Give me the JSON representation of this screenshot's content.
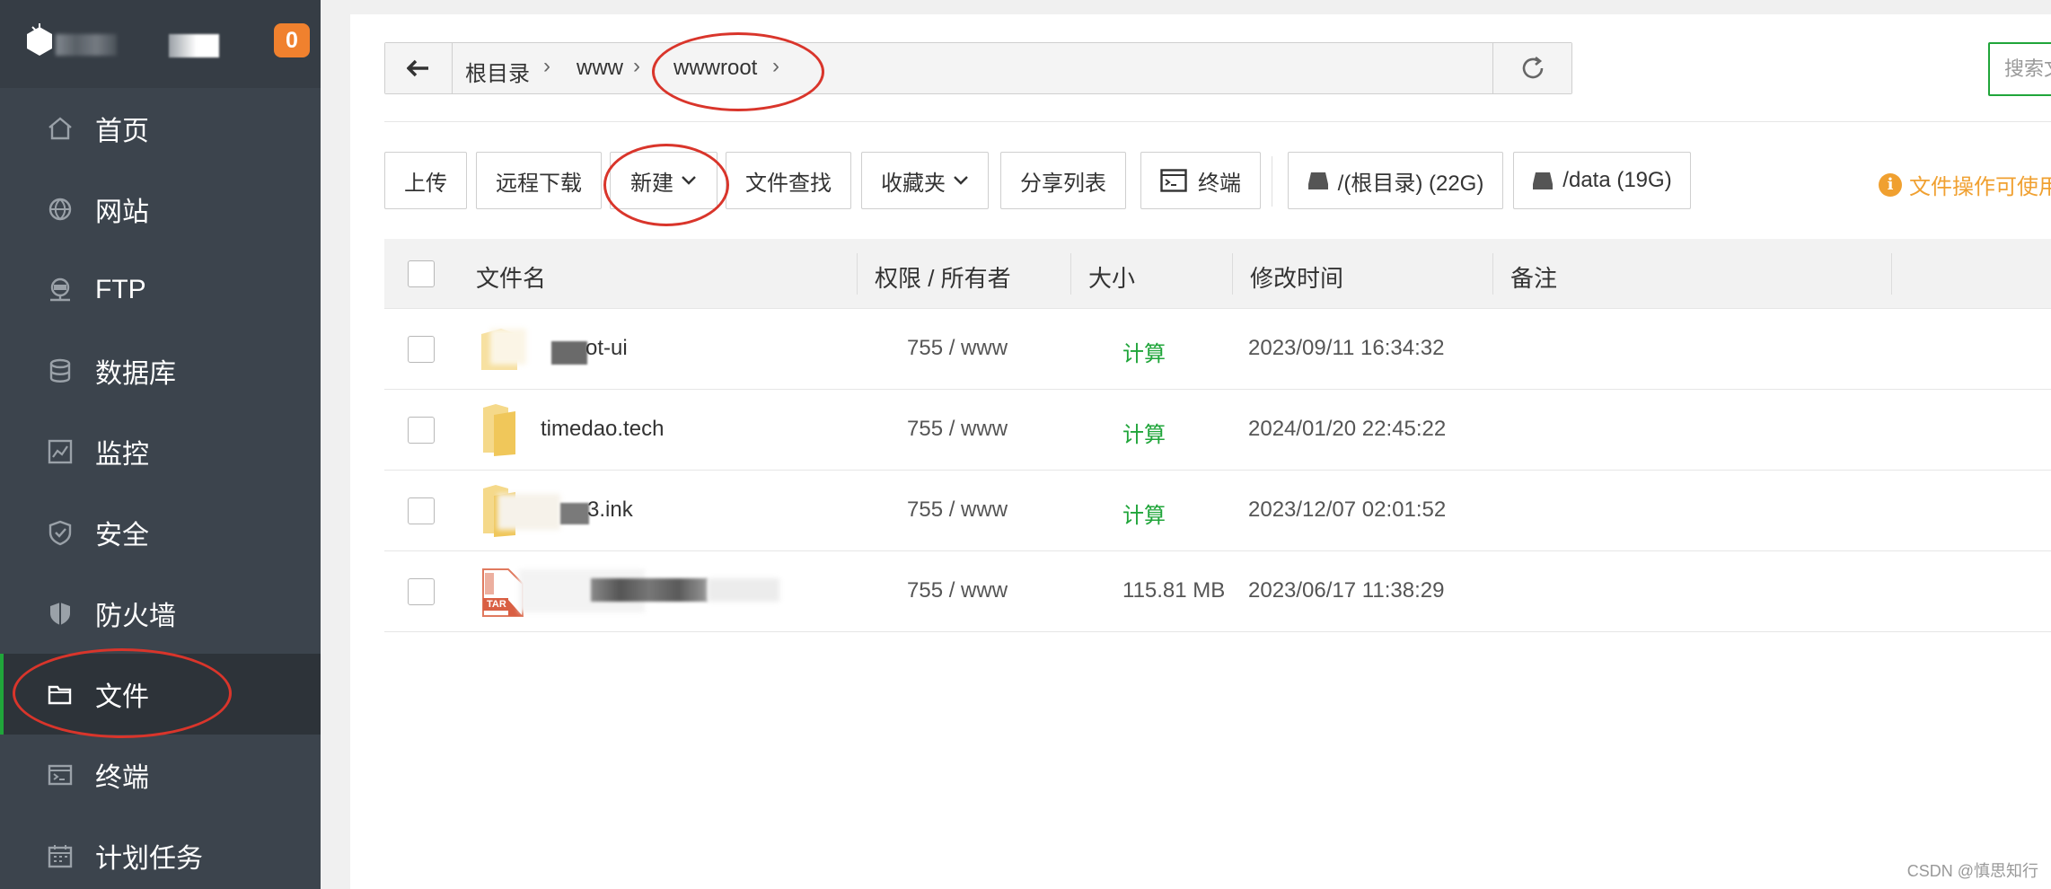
{
  "sidebar": {
    "badge": "0",
    "items": [
      {
        "label": "首页",
        "icon": "home-icon"
      },
      {
        "label": "网站",
        "icon": "globe-icon"
      },
      {
        "label": "FTP",
        "icon": "ftp-server-icon"
      },
      {
        "label": "数据库",
        "icon": "database-icon"
      },
      {
        "label": "监控",
        "icon": "monitor-chart-icon"
      },
      {
        "label": "安全",
        "icon": "shield-check-icon"
      },
      {
        "label": "防火墙",
        "icon": "firewall-shield-icon"
      },
      {
        "label": "文件",
        "icon": "folder-icon",
        "active": true
      },
      {
        "label": "终端",
        "icon": "terminal-icon"
      },
      {
        "label": "计划任务",
        "icon": "calendar-icon"
      }
    ]
  },
  "path": {
    "crumbs": [
      "根目录",
      "www",
      "wwwroot"
    ]
  },
  "search": {
    "placeholder": "搜索文"
  },
  "toolbar": {
    "upload": "上传",
    "remote_download": "远程下载",
    "new": "新建",
    "file_search": "文件查找",
    "favorites": "收藏夹",
    "share_list": "分享列表",
    "terminal": "终端",
    "disk_root": "/(根目录) (22G)",
    "disk_data": "/data (19G)",
    "tip": "文件操作可使用"
  },
  "table": {
    "headers": {
      "name": "文件名",
      "perm": "权限 / 所有者",
      "size": "大小",
      "mtime": "修改时间",
      "note": "备注"
    },
    "rows": [
      {
        "name": "ot-ui",
        "perm": "755 / www",
        "size": "计算",
        "mtime": "2023/09/11 16:34:32",
        "type": "folder"
      },
      {
        "name": "timedao.tech",
        "perm": "755 / www",
        "size": "计算",
        "mtime": "2024/01/20 22:45:22",
        "type": "folder"
      },
      {
        "name": "3.ink",
        "perm": "755 / www",
        "size": "计算",
        "mtime": "2023/12/07 02:01:52",
        "type": "folder"
      },
      {
        "name": "",
        "perm": "755 / www",
        "size": "115.81 MB",
        "mtime": "2023/06/17 11:38:29",
        "type": "tar",
        "icon_label": "TAR"
      }
    ]
  },
  "watermark": "CSDN @慎思知行",
  "colors": {
    "accent": "#20a53a",
    "sidebar_bg": "#3c444d",
    "badge": "#f0812e",
    "annotation": "#d9352b",
    "tip": "#f0a030"
  }
}
